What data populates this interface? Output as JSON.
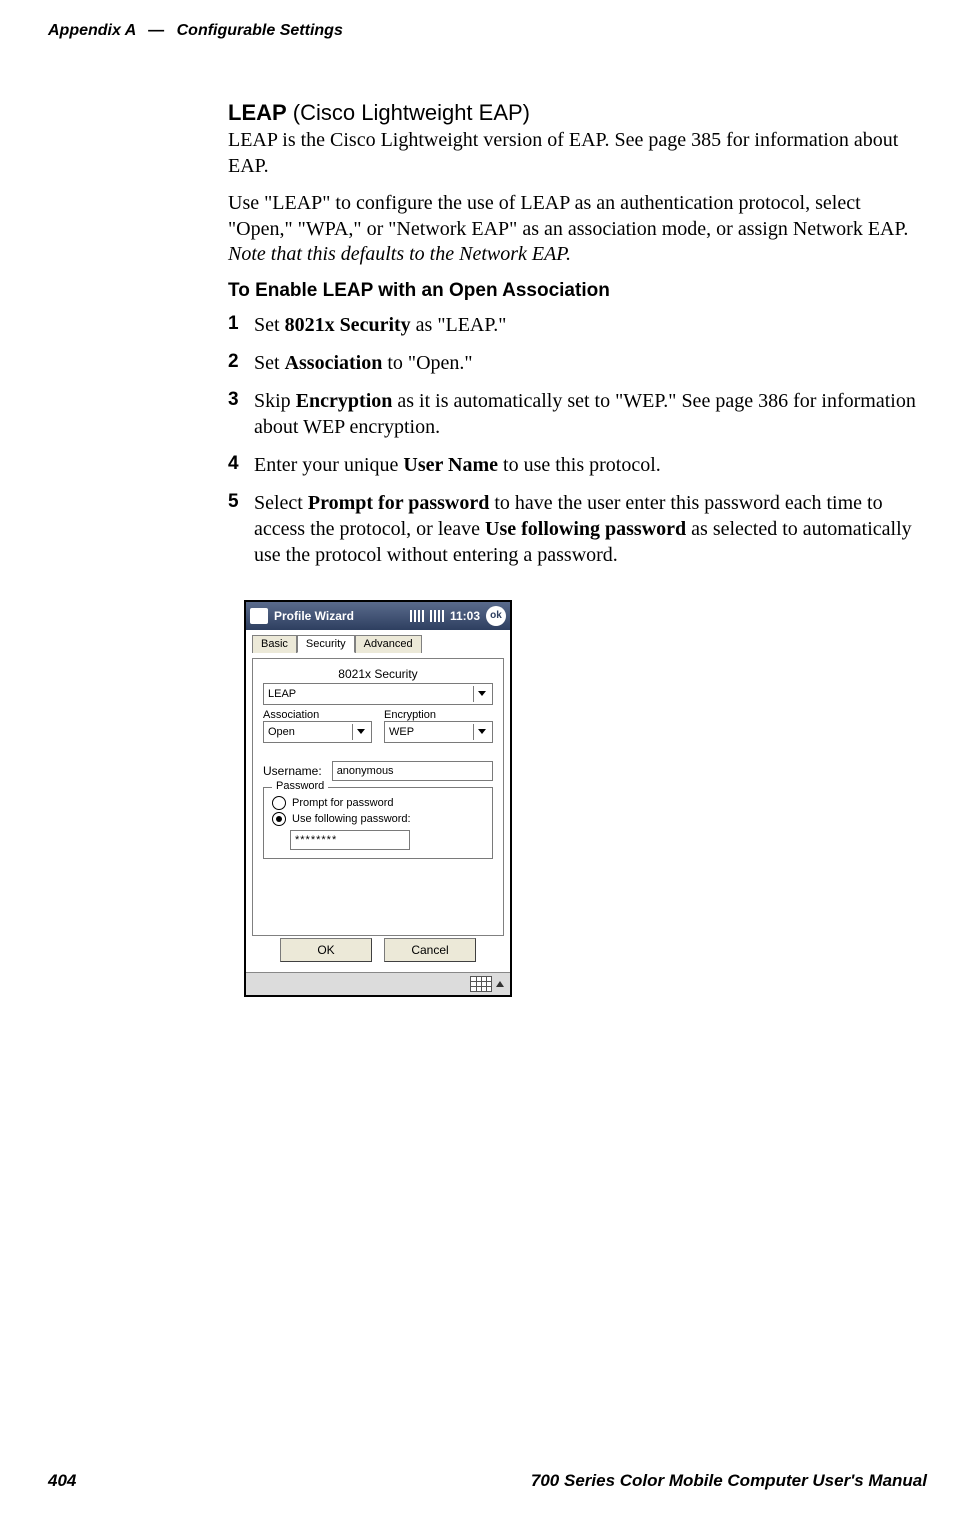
{
  "header": {
    "appendix": "Appendix  A",
    "dash": "—",
    "section": "Configurable Settings"
  },
  "body": {
    "h1_bold": "LEAP",
    "h1_light": " (Cisco Lightweight EAP)",
    "para1": "LEAP is the Cisco Lightweight version of EAP. See page 385 for information about EAP.",
    "para2a": "Use \"LEAP\" to configure the use of LEAP as an authentication protocol, select \"Open,\" \"WPA,\" or \"Network EAP\" as an association mode, or assign Network EAP. ",
    "para2_italic": "Note that this defaults to the Network EAP.",
    "h2": "To Enable LEAP with an Open Association",
    "steps": {
      "s1_a": "Set ",
      "s1_b": "8021x Security",
      "s1_c": " as \"LEAP.\"",
      "s2_a": "Set ",
      "s2_b": "Association",
      "s2_c": " to \"Open.\"",
      "s3_a": "Skip ",
      "s3_b": "Encryption",
      "s3_c": " as it is automatically set to \"WEP.\" See page 386 for information about WEP encryption.",
      "s4_a": "Enter your unique ",
      "s4_b": "User Name",
      "s4_c": " to use this protocol.",
      "s5_a": "Select ",
      "s5_b": "Prompt for password",
      "s5_c": " to have the user enter this password each time to access the protocol, or leave ",
      "s5_d": "Use following password",
      "s5_e": " as selected to automatically use the protocol without entering a password."
    }
  },
  "shot": {
    "title": "Profile Wizard",
    "time": "11:03",
    "ok": "ok",
    "tabs": {
      "basic": "Basic",
      "security": "Security",
      "advanced": "Advanced"
    },
    "panel": {
      "sec_label": "8021x Security",
      "sec_value": "LEAP",
      "assoc_label": "Association",
      "assoc_value": "Open",
      "enc_label": "Encryption",
      "enc_value": "WEP",
      "user_label": "Username:",
      "user_value": "anonymous",
      "pw_group": "Password",
      "radio_prompt": "Prompt for password",
      "radio_usepw": "Use following password:",
      "pw_value": "********",
      "ok_btn": "OK",
      "cancel_btn": "Cancel"
    }
  },
  "footer": {
    "page": "404",
    "title": "700 Series Color Mobile Computer User's Manual"
  }
}
